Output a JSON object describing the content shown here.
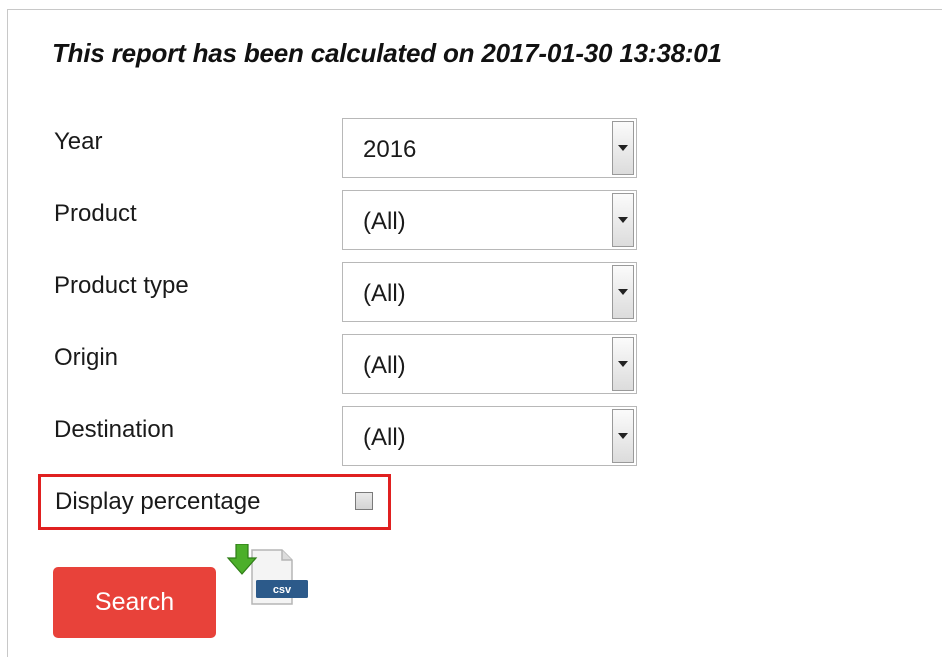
{
  "report": {
    "title": "This report has been calculated on 2017-01-30 13:38:01"
  },
  "filters": [
    {
      "label": "Year",
      "value": "2016"
    },
    {
      "label": "Product",
      "value": "(All)"
    },
    {
      "label": "Product type",
      "value": "(All)"
    },
    {
      "label": "Origin",
      "value": "(All)"
    },
    {
      "label": "Destination",
      "value": "(All)"
    }
  ],
  "display_percentage": {
    "label": "Display percentage",
    "checked": false
  },
  "actions": {
    "search_label": "Search",
    "csv_label": "csv",
    "csv_icon": "csv-download-icon"
  },
  "colors": {
    "search_button": "#e8423a",
    "highlight_border": "#e02020",
    "csv_arrow": "#4caf2a",
    "csv_badge": "#2c5a8a"
  }
}
